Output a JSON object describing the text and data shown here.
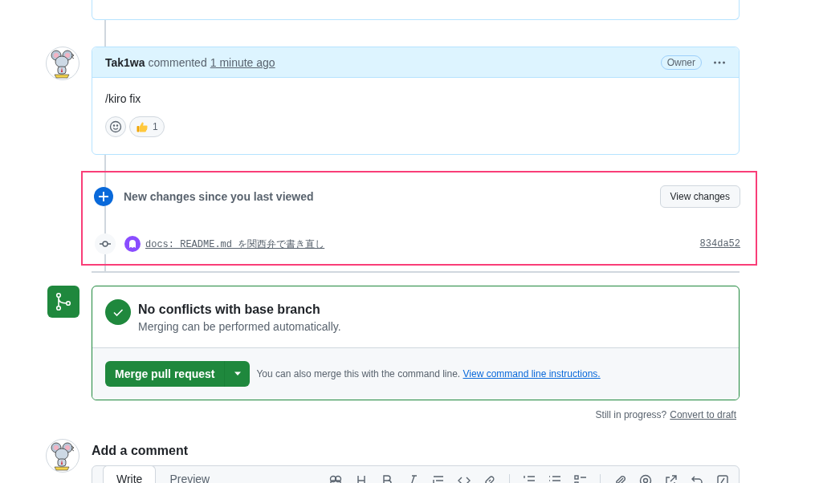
{
  "comment": {
    "author": "Tak1wa",
    "action": "commented",
    "time": "1 minute ago",
    "badge": "Owner",
    "body": "/kiro fix",
    "reactions": [
      {
        "kind": "thumbs-up",
        "count": "1"
      }
    ]
  },
  "new_changes": {
    "title": "New changes since you last viewed",
    "button": "View changes",
    "commits": [
      {
        "message": "docs: README.md を関西弁で書き直し",
        "sha": "834da52"
      }
    ]
  },
  "merge": {
    "title": "No conflicts with base branch",
    "subtitle": "Merging can be performed automatically.",
    "button": "Merge pull request",
    "hint": "You can also merge this with the command line.",
    "link": "View command line instructions."
  },
  "draft": {
    "question": "Still in progress?",
    "link": "Convert to draft"
  },
  "add_comment": {
    "title": "Add a comment",
    "tabs": [
      {
        "label": "Write",
        "selected": true
      },
      {
        "label": "Preview",
        "selected": false
      }
    ]
  }
}
